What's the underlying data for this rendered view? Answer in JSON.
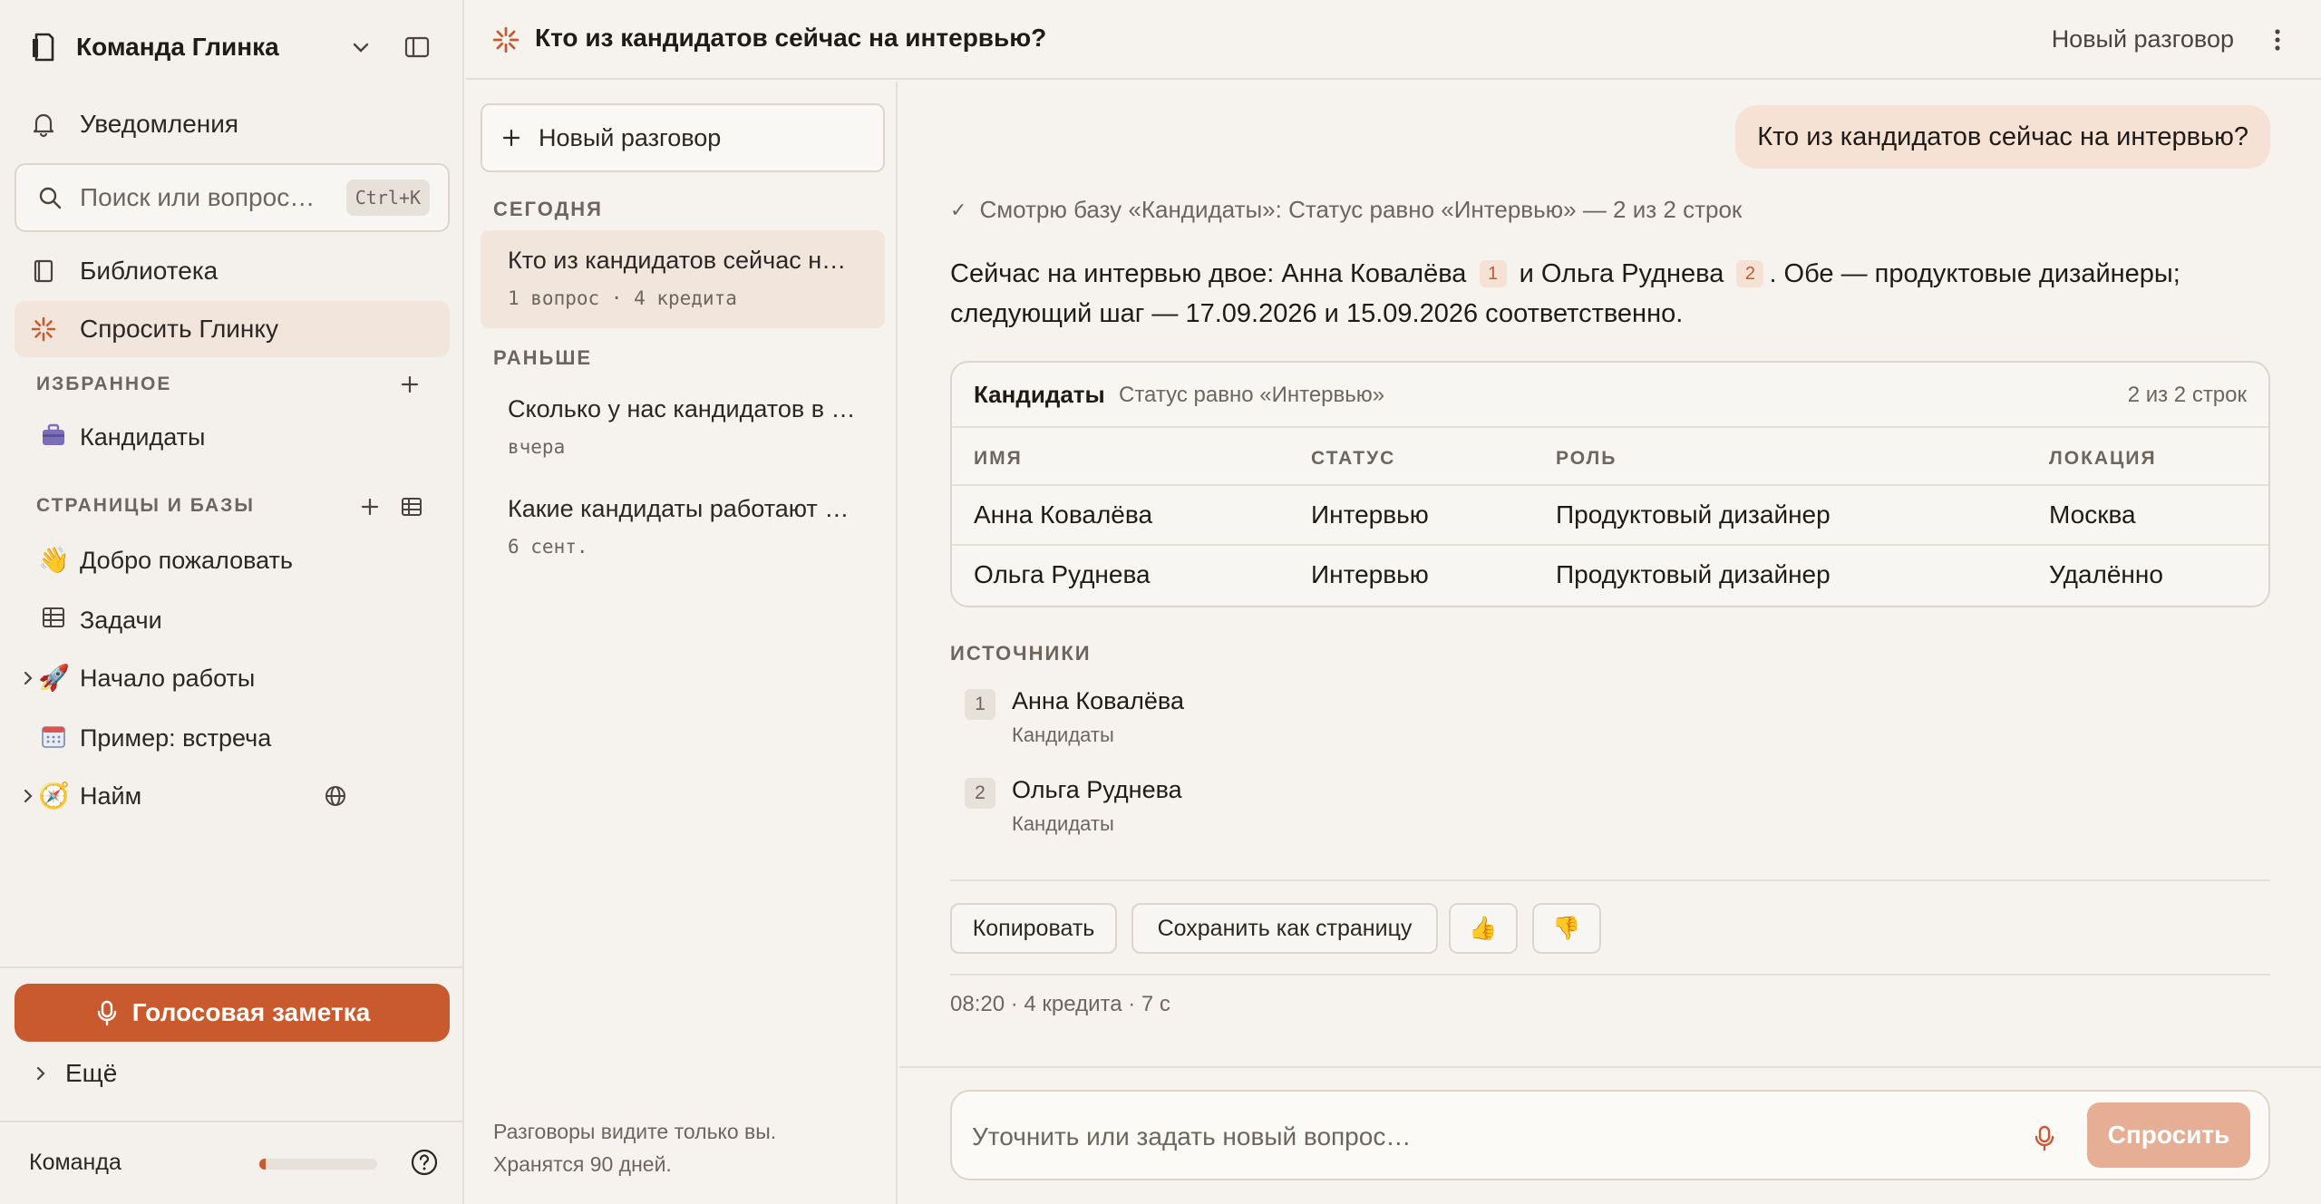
{
  "workspace": {
    "name": "Команда Глинка"
  },
  "nav": {
    "notifications": "Уведомления",
    "search_placeholder": "Поиск или вопрос…",
    "search_shortcut": "Ctrl+K",
    "library": "Библиотека",
    "ask": "Спросить Глинку"
  },
  "favorites": {
    "label": "ИЗБРАННОЕ",
    "items": [
      {
        "label": "Кандидаты",
        "icon": "briefcase-icon"
      }
    ]
  },
  "pages": {
    "label": "СТРАНИЦЫ И БАЗЫ",
    "items": [
      {
        "label": "Добро пожаловать",
        "icon": "wave-hand-icon"
      },
      {
        "label": "Задачи",
        "icon": "table-icon"
      },
      {
        "label": "Начало работы",
        "icon": "rocket-icon"
      },
      {
        "label": "Пример: встреча",
        "icon": "calendar-icon"
      },
      {
        "label": "Найм",
        "icon": "compass-icon"
      }
    ]
  },
  "voice_note": "Голосовая заметка",
  "more": "Ещё",
  "team": {
    "label": "Команда",
    "usage_fraction": 0.05
  },
  "topbar": {
    "title": "Кто из кандидатов сейчас на интервью?",
    "new_conversation": "Новый разговор"
  },
  "history": {
    "new_button": "Новый разговор",
    "today_label": "СЕГОДНЯ",
    "earlier_label": "РАНЬШЕ",
    "today": [
      {
        "title": "Кто из кандидатов сейчас на интервью?",
        "meta": "1 вопрос · 4 кредита"
      }
    ],
    "earlier": [
      {
        "title": "Сколько у нас кандидатов в базе?",
        "meta": "вчера"
      },
      {
        "title": "Какие кандидаты работают удалённо?",
        "meta": "6 сент."
      }
    ],
    "footer_line1": "Разговоры видите только вы.",
    "footer_line2": "Хранятся 90 дней."
  },
  "chat": {
    "user_message": "Кто из кандидатов сейчас на интервью?",
    "tool_status": "Смотрю базу «Кандидаты»: Статус равно «Интервью» — 2 из 2 строк",
    "answer": {
      "p1": "Сейчас на интервью двое: Анна Ковалёва",
      "c1": "1",
      "p2": "и Ольга Руднева",
      "c2": "2",
      "p3": ". Обе — продуктовые дизайнеры;",
      "p4": "следующий шаг — 17.09.2026 и 15.09.2026 соответственно."
    },
    "table": {
      "name": "Кандидаты",
      "filter": "Статус равно «Интервью»",
      "count": "2 из 2 строк",
      "columns": [
        "ИМЯ",
        "СТАТУС",
        "РОЛЬ",
        "ЛОКАЦИЯ"
      ],
      "rows": [
        [
          "Анна Ковалёва",
          "Интервью",
          "Продуктовый дизайнер",
          "Москва"
        ],
        [
          "Ольга Руднева",
          "Интервью",
          "Продуктовый дизайнер",
          "Удалённо"
        ]
      ]
    },
    "sources_label": "ИСТОЧНИКИ",
    "sources": [
      {
        "num": "1",
        "title": "Анна Ковалёва",
        "sub": "Кандидаты"
      },
      {
        "num": "2",
        "title": "Ольга Руднева",
        "sub": "Кандидаты"
      }
    ],
    "actions": {
      "copy": "Копировать",
      "save": "Сохранить как страницу",
      "like": "👍",
      "dislike": "👎"
    },
    "meta": "08:20 · 4 кредита · 7 с"
  },
  "composer": {
    "placeholder": "Уточнить или задать новый вопрос…",
    "ask": "Спросить"
  },
  "colors": {
    "accent": "#c85a2e",
    "active_bg": "#f2e5dc",
    "bubble": "#f6e1d5"
  }
}
